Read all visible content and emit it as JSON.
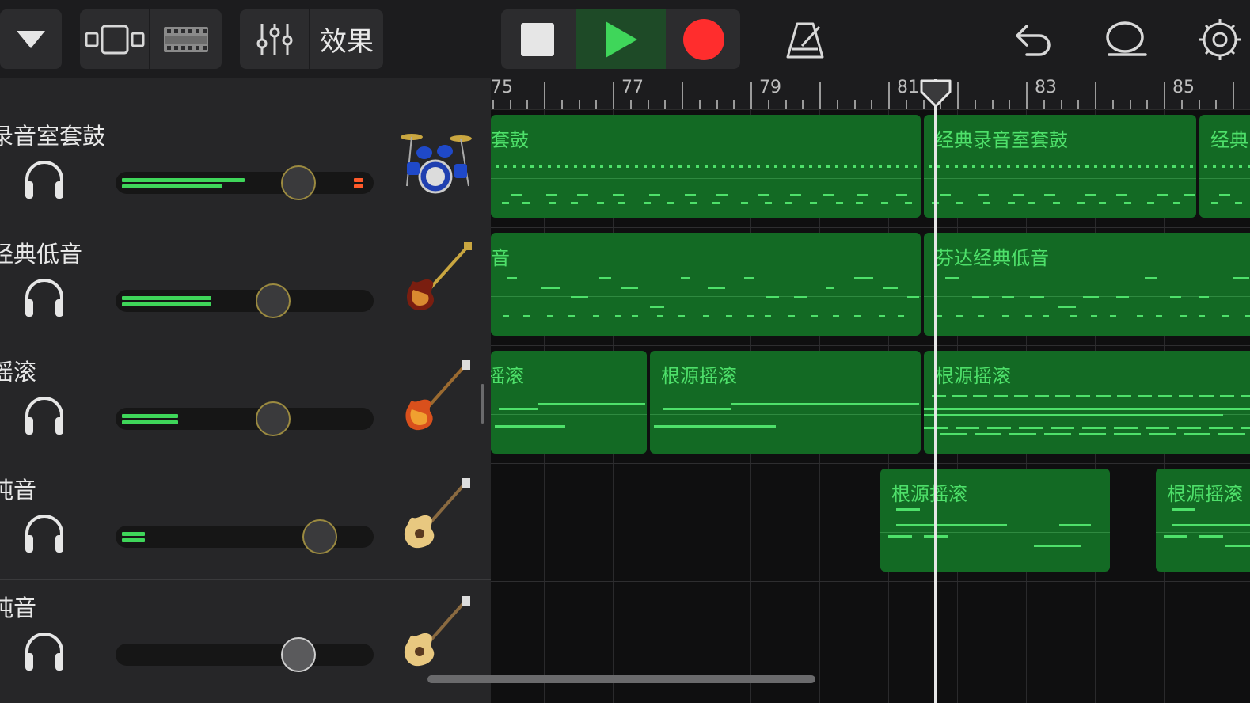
{
  "toolbar": {
    "effects_label": "效果"
  },
  "ruler": {
    "bar_numbers": [
      "75",
      "77",
      "79",
      "81",
      "83",
      "85"
    ]
  },
  "tracks": [
    {
      "name": "录音室套鼓",
      "instrument": "drum-kit-icon",
      "volume_meter": [
        0.48,
        0.39
      ],
      "clip": true
    },
    {
      "name": "经典低音",
      "instrument": "bass-guitar-icon",
      "volume_meter": [
        0.35,
        0.35
      ],
      "clip": false
    },
    {
      "name": "摇滚",
      "instrument": "electric-guitar-icon",
      "volume_meter": [
        0.22,
        0.22
      ],
      "clip": false
    },
    {
      "name": "纯音",
      "instrument": "acoustic-guitar-icon",
      "volume_meter": [
        0.09,
        0.09
      ],
      "clip": false
    },
    {
      "name": "纯音",
      "instrument": "acoustic-guitar-icon",
      "volume_meter": [
        0,
        0
      ],
      "clip": false
    }
  ],
  "regions": {
    "r0a": "套鼓",
    "r0b": "经典录音室套鼓",
    "r0c": "经典",
    "r1a": "音",
    "r1b": "芬达经典低音",
    "r2a": "摇滚",
    "r2b": "根源摇滚",
    "r2c": "根源摇滚",
    "r3a": "根源摇滚",
    "r3b": "根源摇滚"
  },
  "colors": {
    "accent_green": "#4ee06a",
    "region_green": "#136a24",
    "record_red": "#ff2d2d"
  }
}
